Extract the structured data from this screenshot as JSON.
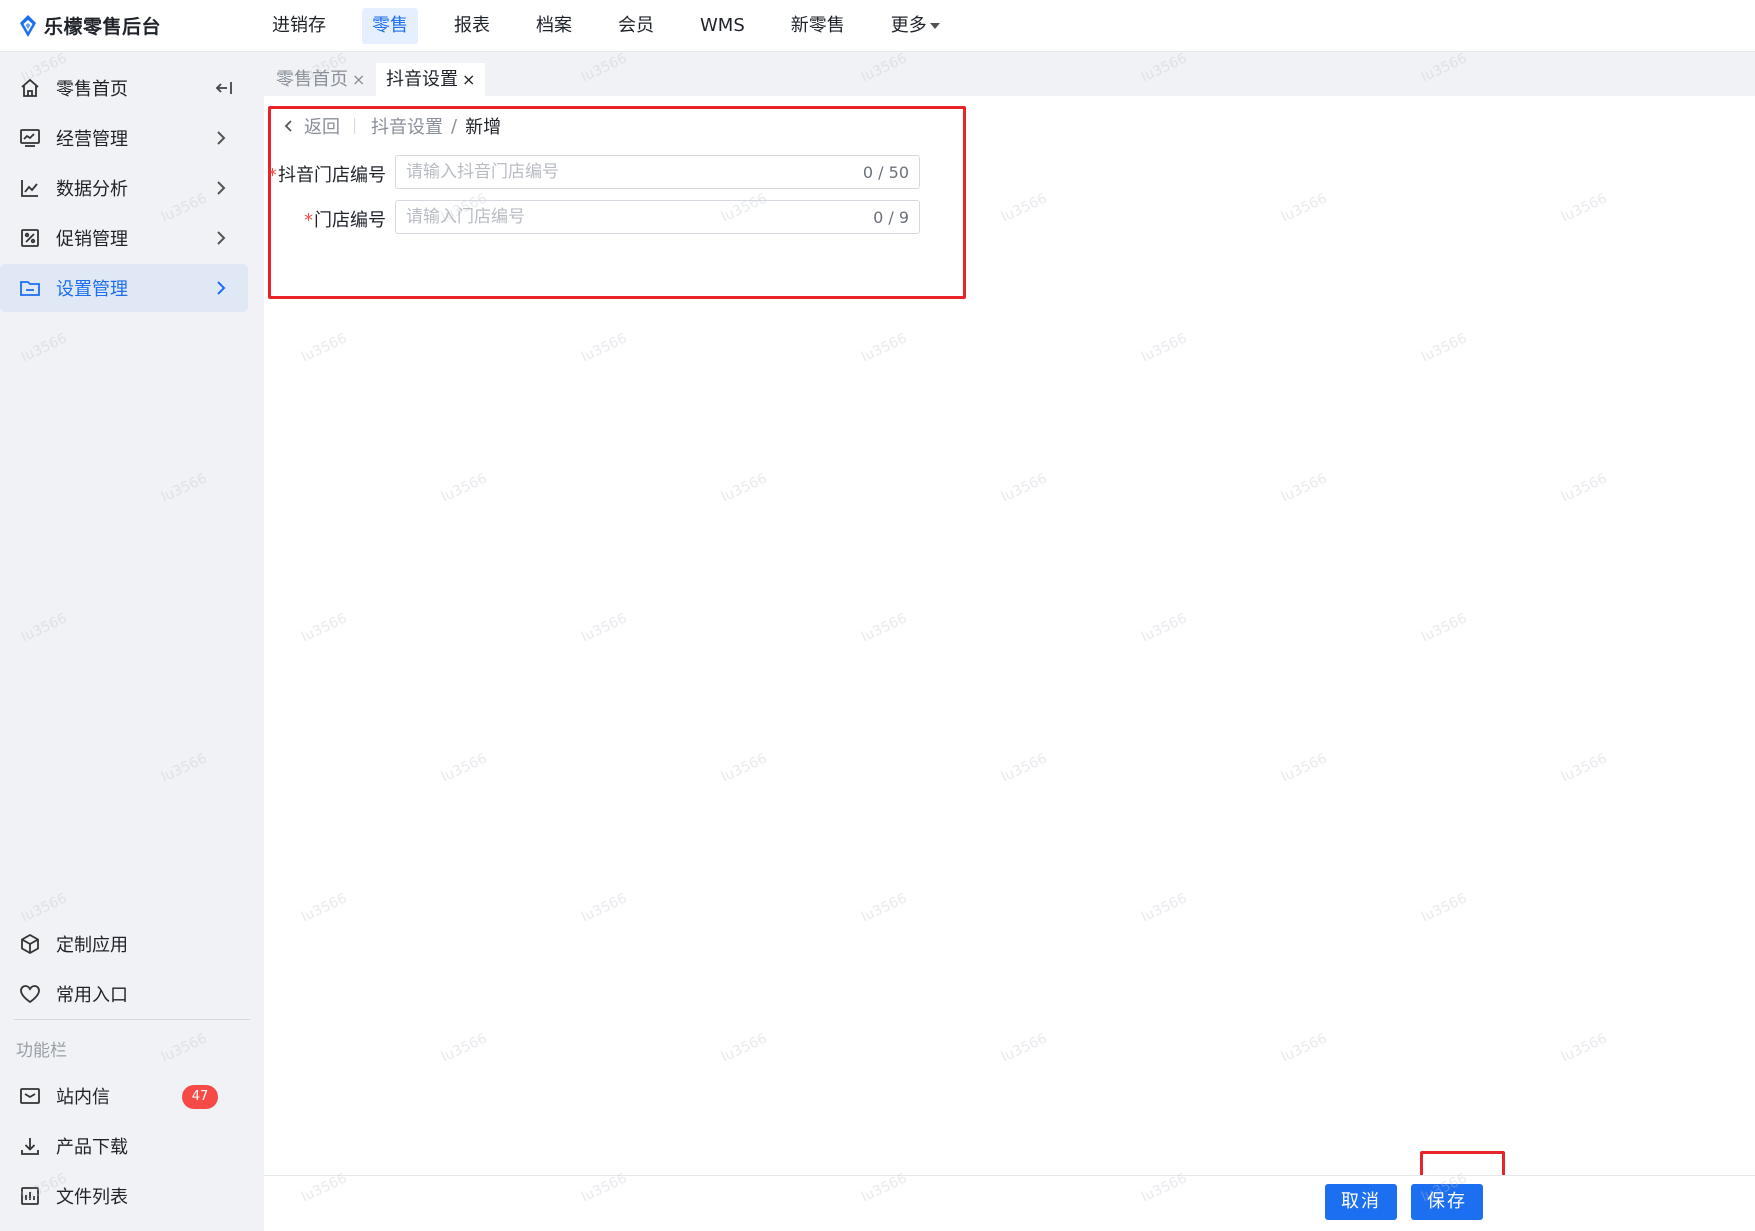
{
  "app": {
    "title": "乐檬零售后台",
    "brand_color": "#1d6ff2"
  },
  "topnav": {
    "items": [
      {
        "label": "进销存"
      },
      {
        "label": "零售",
        "active": true
      },
      {
        "label": "报表"
      },
      {
        "label": "档案"
      },
      {
        "label": "会员"
      },
      {
        "label": "WMS"
      },
      {
        "label": "新零售"
      },
      {
        "label": "更多"
      }
    ]
  },
  "sidebar": {
    "items": [
      {
        "label": "零售首页",
        "icon": "home-icon"
      },
      {
        "label": "经营管理",
        "icon": "monitor-icon"
      },
      {
        "label": "数据分析",
        "icon": "chart-line-icon"
      },
      {
        "label": "促销管理",
        "icon": "promo-icon"
      },
      {
        "label": "设置管理",
        "icon": "folder-icon",
        "active": true
      }
    ],
    "bottom_items": [
      {
        "label": "定制应用",
        "icon": "cube-icon"
      },
      {
        "label": "常用入口",
        "icon": "heart-icon"
      }
    ],
    "section_title": "功能栏",
    "function_items": [
      {
        "label": "站内信",
        "icon": "mail-icon",
        "badge": "47"
      },
      {
        "label": "产品下载",
        "icon": "download-icon"
      },
      {
        "label": "文件列表",
        "icon": "file-list-icon"
      }
    ]
  },
  "tabs": [
    {
      "label": "零售首页",
      "close": "×",
      "active": false
    },
    {
      "label": "抖音设置",
      "close": "×",
      "active": true
    }
  ],
  "breadcrumb": {
    "back": "返回",
    "parent": "抖音设置",
    "separator": "/",
    "current": "新增"
  },
  "form": {
    "fields": [
      {
        "required_mark": "*",
        "label": "抖音门店编号",
        "placeholder": "请输入抖音门店编号",
        "value": "",
        "count": "0 / 50"
      },
      {
        "required_mark": "*",
        "label": "门店编号",
        "placeholder": "请输入门店编号",
        "value": "",
        "count": "0 / 9"
      }
    ]
  },
  "footer": {
    "cancel_label": "取消",
    "save_label": "保存"
  },
  "watermark": "lu3566"
}
